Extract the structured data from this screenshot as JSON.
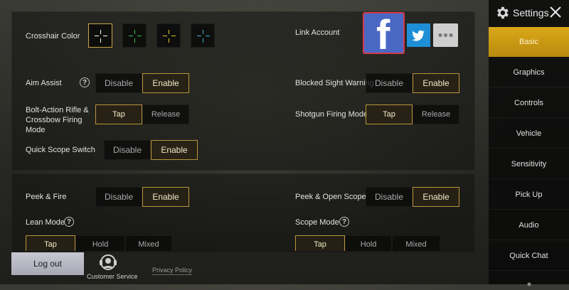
{
  "sidebar": {
    "title": "Settings",
    "items": [
      {
        "label": "Basic",
        "active": true
      },
      {
        "label": "Graphics",
        "active": false
      },
      {
        "label": "Controls",
        "active": false
      },
      {
        "label": "Vehicle",
        "active": false
      },
      {
        "label": "Sensitivity",
        "active": false
      },
      {
        "label": "Pick Up",
        "active": false
      },
      {
        "label": "Audio",
        "active": false
      },
      {
        "label": "Quick Chat",
        "active": false
      }
    ]
  },
  "crosshair": {
    "label": "Crosshair Color",
    "colors": [
      "#ffffff",
      "#36c24a",
      "#e3c630",
      "#37b8c8"
    ]
  },
  "link_account": {
    "label": "Link Account",
    "facebook": "f"
  },
  "aim_assist": {
    "label": "Aim Assist",
    "help": "?",
    "options": [
      "Disable",
      "Enable"
    ],
    "selected": "Enable"
  },
  "blocked_sight": {
    "label": "Blocked Sight Warning",
    "options": [
      "Disable",
      "Enable"
    ],
    "selected": "Enable"
  },
  "bolt_action": {
    "label": "Bolt-Action Rifle & Crossbow Firing Mode",
    "options": [
      "Tap",
      "Release"
    ],
    "selected": "Tap"
  },
  "shotgun": {
    "label": "Shotgun Firing Mode",
    "options": [
      "Tap",
      "Release"
    ],
    "selected": "Tap"
  },
  "quick_scope": {
    "label": "Quick Scope Switch",
    "options": [
      "Disable",
      "Enable"
    ],
    "selected": "Enable"
  },
  "peek_fire": {
    "label": "Peek & Fire",
    "options": [
      "Disable",
      "Enable"
    ],
    "selected": "Enable"
  },
  "peek_scope": {
    "label": "Peek & Open Scope",
    "options": [
      "Disable",
      "Enable"
    ],
    "selected": "Enable"
  },
  "lean_mode": {
    "label": "Lean Mode",
    "help": "?",
    "options": [
      "Tap",
      "Hold",
      "Mixed"
    ],
    "selected": "Tap"
  },
  "scope_mode": {
    "label": "Scope Mode",
    "help": "?",
    "options": [
      "Tap",
      "Hold",
      "Mixed"
    ],
    "selected": "Tap"
  },
  "footer": {
    "logout": "Log out",
    "customer_service": "Customer Service",
    "privacy": "Privacy Policy"
  },
  "colors": {
    "accent": "#c9a847",
    "active_tab": "#d9a818",
    "facebook": "#3b5bb5",
    "twitter": "#1e8fd6"
  }
}
